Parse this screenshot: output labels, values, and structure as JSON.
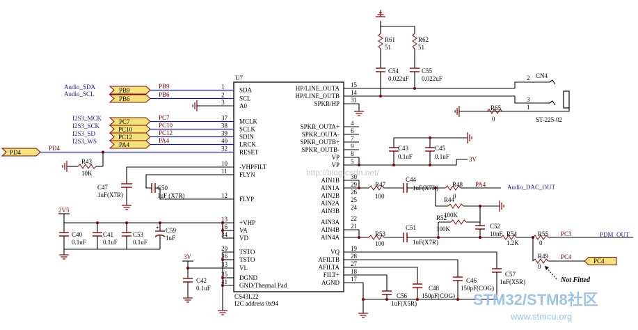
{
  "chip": {
    "ref": "U7",
    "part": "CS43L22",
    "addr": "I2C address 0x94",
    "left_pins": [
      {
        "num": "1",
        "name": "SDA"
      },
      {
        "num": "2",
        "name": "SCL"
      },
      {
        "num": "3",
        "name": "A0"
      },
      {
        "num": "37",
        "name": "MCLK"
      },
      {
        "num": "38",
        "name": "SCLK"
      },
      {
        "num": "39",
        "name": "SDIN"
      },
      {
        "num": "40",
        "name": "LRCK"
      },
      {
        "num": "32",
        "name": "RESET"
      },
      {
        "num": "10",
        "name": "-VHPFILT"
      },
      {
        "num": "11",
        "name": "FLYN"
      },
      {
        "num": "12",
        "name": "FLYP"
      },
      {
        "num": "13",
        "name": "+VHP"
      },
      {
        "num": "16",
        "name": "VA"
      },
      {
        "num": "34",
        "name": "VD"
      },
      {
        "num": "20",
        "name": "TSTO"
      },
      {
        "num": "36",
        "name": "TSTO"
      },
      {
        "num": "33",
        "name": "VL"
      },
      {
        "num": "35",
        "name": "DGND"
      },
      {
        "num": "41",
        "name": "GND/Thermal Pad"
      }
    ],
    "right_pins": [
      {
        "num": "15",
        "name": "HP/LINE_OUTA"
      },
      {
        "num": "14",
        "name": "HP/LINE_OUTB"
      },
      {
        "num": "31",
        "name": "SPKR/HP"
      },
      {
        "num": "4",
        "name": "SPKR_OUTA+"
      },
      {
        "num": "6",
        "name": "SPKR_OUTA-"
      },
      {
        "num": "7",
        "name": "SPKR_OUTB+"
      },
      {
        "num": "9",
        "name": "SPKR_OUTB-"
      },
      {
        "num": "8",
        "name": "VP"
      },
      {
        "num": "5",
        "name": "VP"
      },
      {
        "num": "30",
        "name": "AIN1B"
      },
      {
        "num": "29",
        "name": "AIN1A"
      },
      {
        "num": "26",
        "name": "AIN2B"
      },
      {
        "num": "25",
        "name": "AIN2A"
      },
      {
        "num": "24",
        "name": "AIN3B"
      },
      {
        "num": "22",
        "name": "AIN3A"
      },
      {
        "num": "21",
        "name": "AIN4B"
      },
      {
        "num": "",
        "name": "AIN4A"
      },
      {
        "num": "19",
        "name": "VQ"
      },
      {
        "num": "28",
        "name": "AFILTB"
      },
      {
        "num": "27",
        "name": "AFILTA"
      },
      {
        "num": "18",
        "name": "FILT+"
      },
      {
        "num": "17",
        "name": "AGND"
      }
    ]
  },
  "ports": {
    "pb9": "PB9",
    "pb6": "PB6",
    "pc7": "PC7",
    "pc10": "PC10",
    "pc12": "PC12",
    "pa4": "PA4",
    "pd4": "PD4",
    "pc4": "PC4"
  },
  "nets": {
    "audio_sda": "Audio_SDA",
    "audio_scl": "Audio_SCL",
    "i2s3_mck": "I2S3_MCK",
    "i2s3_sck": "I2S3_SCK",
    "i2s3_sd": "I2S3_SD",
    "i2s3_ws": "I2S3_WS",
    "pb9": "PB9",
    "pb6": "PB6",
    "pc7": "PC7",
    "pc10": "PC10",
    "pc12": "PC12",
    "pa4": "PA4",
    "pd4": "PD4",
    "pa4_out": "PA4",
    "audio_dac_out": "Audio_DAC_OUT",
    "pc3": "PC3",
    "pdm_out": "PDM_OUT",
    "pc4": "PC4",
    "v2v5": "2V5",
    "v3v_a": "3V",
    "v3v_b": "3V"
  },
  "components": {
    "r61": "R61",
    "r61v": "51",
    "r62": "R62",
    "r62v": "51",
    "c54": "C54",
    "c54v": "0.022uF",
    "c55": "C55",
    "c55v": "0.022uF",
    "cn4": "CN4",
    "cn4p": "ST-225-02",
    "cn4_2": "2",
    "cn4_3": "3",
    "cn4_1": "1",
    "r65": "R65",
    "r65v": "0",
    "r43": "R43",
    "r43v": "10K",
    "c47": "C47",
    "c47v": "1uF(X7R)",
    "c50": "C50",
    "c50v": "1uF (X7R)",
    "c43": "C43",
    "c43v": "0.1uF",
    "c45": "C45",
    "c45v": "0.1uF",
    "r47": "R47",
    "r47v": "100",
    "c44": "C44",
    "c44v": "1uF(X7R)",
    "r48": "R48",
    "r48v": "0",
    "r44": "R44",
    "r44v": "100K",
    "r52": "R52",
    "r52v": "100K",
    "r53": "R53",
    "r53v": "100",
    "c51": "C51",
    "c51v": "1uF(X7R)",
    "c52": "C52",
    "c52v": "10nF",
    "r54": "R54",
    "r54v": "1.2K",
    "r55": "R55",
    "r55v": "0",
    "r49": "R49",
    "r49v": "0",
    "c40": "C40",
    "c40v": "0.1uF",
    "c41": "C41",
    "c41v": "0.1uF",
    "c53": "C53",
    "c53v": "0.1uF",
    "c59": "C59",
    "c59v": "1uF",
    "c42": "C42",
    "c42v": "0.1uF",
    "c56": "C56",
    "c56v": "1uF(X5R)",
    "c48": "C48",
    "c48v": "150pF(COG)",
    "c46": "C46",
    "c46v": "150pF(COG)",
    "c57": "C57",
    "c57v": "1uF(X5R)"
  },
  "notes": {
    "not_fitted": "Not Fitted",
    "blog": "http://blog.csdn.net/"
  },
  "watermark": {
    "brand": "STM32/STM8社区",
    "url": "www.stmcu.org"
  },
  "colors": {
    "wire": "#000000",
    "component": "#8b0000",
    "port_fill": "#f6e27a",
    "net_label": "#7a0000",
    "watermark": "#9ec3e6"
  }
}
